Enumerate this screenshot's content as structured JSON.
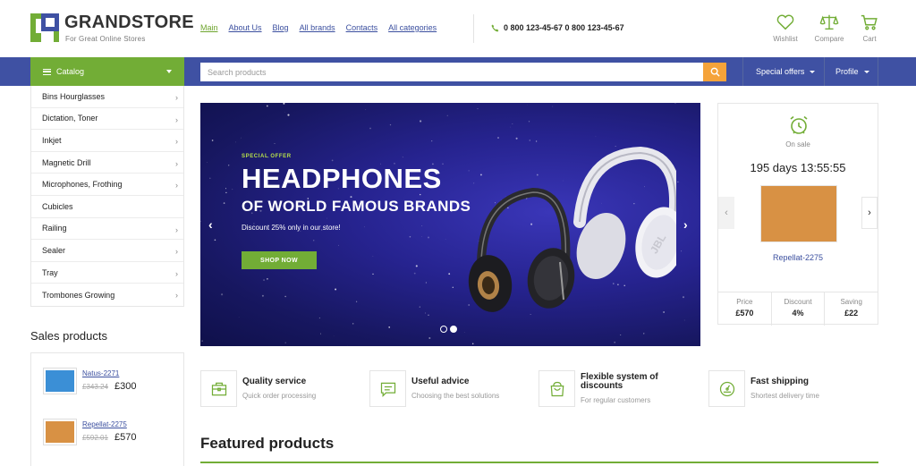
{
  "brand": {
    "name": "GRANDSTORE",
    "tagline": "For Great Online Stores"
  },
  "nav": [
    {
      "label": "Main",
      "active": true
    },
    {
      "label": "About Us"
    },
    {
      "label": "Blog"
    },
    {
      "label": "All brands"
    },
    {
      "label": "Contacts"
    },
    {
      "label": "All categories"
    }
  ],
  "phone": "0 800 123-45-67 0 800 123-45-67",
  "header_actions": {
    "wishlist": "Wishlist",
    "compare": "Compare",
    "cart": "Cart"
  },
  "bar": {
    "catalog_label": "Catalog",
    "search_placeholder": "Search products",
    "special_offers": "Special offers",
    "profile": "Profile"
  },
  "catalog": [
    "Bins Hourglasses",
    "Dictation, Toner",
    "Inkjet",
    "Magnetic Drill",
    "Microphones, Frothing",
    "Cubicles",
    "Railing",
    "Sealer",
    "Tray",
    "Trombones Growing"
  ],
  "sales": {
    "title": "Sales products",
    "items": [
      {
        "name": "Natus-2271",
        "old_price": "£343.24",
        "price": "£300",
        "color": "#3b8fd6"
      },
      {
        "name": "Repellat-2275",
        "old_price": "£592.01",
        "price": "£570",
        "color": "#d89144"
      }
    ]
  },
  "banner": {
    "kicker": "SPECIAL OFFER",
    "headline": "HEADPHONES",
    "subheadline": "OF WORLD FAMOUS BRANDS",
    "text": "Discount 25% only in our store!",
    "button": "SHOP NOW",
    "slides": 2,
    "active_slide": 2
  },
  "deal": {
    "status": "On sale",
    "timer": "195 days 13:55:55",
    "product": "Repellat-2275",
    "image_color": "#d89144",
    "price_label": "Price",
    "price": "£570",
    "discount_label": "Discount",
    "discount": "4%",
    "saving_label": "Saving",
    "saving": "£22"
  },
  "features": [
    {
      "title": "Quality service",
      "subtitle": "Quick order processing",
      "icon": "briefcase-icon"
    },
    {
      "title": "Useful advice",
      "subtitle": "Choosing the best solutions",
      "icon": "chat-icon"
    },
    {
      "title": "Flexible system of discounts",
      "subtitle": "For regular customers",
      "icon": "shopping-bag-icon"
    },
    {
      "title": "Fast shipping",
      "subtitle": "Shortest delivery time",
      "icon": "speedometer-icon"
    }
  ],
  "featured_title": "Featured products",
  "colors": {
    "accent_green": "#72ad36",
    "nav_blue": "#3f51a3",
    "search_orange": "#f5a33a",
    "link_blue": "#3b4f9f"
  }
}
